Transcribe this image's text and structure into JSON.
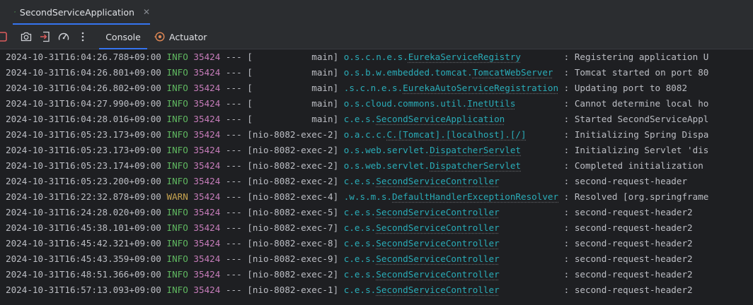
{
  "run_tab": {
    "title": "SecondServiceApplication",
    "close": "✕"
  },
  "toolbar": {
    "console_label": "Console",
    "actuator_label": "Actuator"
  },
  "log": [
    {
      "ts": "2024-10-31T16:04:26.788+09:00",
      "level": "INFO",
      "pid": "35424",
      "thread": "[           main]",
      "pkg": "o.s.c.n.e.s.",
      "cls": "EurekaServiceRegistry",
      "msg": ": Registering application U"
    },
    {
      "ts": "2024-10-31T16:04:26.801+09:00",
      "level": "INFO",
      "pid": "35424",
      "thread": "[           main]",
      "pkg": "o.s.b.w.embedded.tomcat.",
      "cls": "TomcatWebServer",
      "msg": ": Tomcat started on port 80"
    },
    {
      "ts": "2024-10-31T16:04:26.802+09:00",
      "level": "INFO",
      "pid": "35424",
      "thread": "[           main]",
      "pkg": ".s.c.n.e.s.",
      "cls": "EurekaAutoServiceRegistration",
      "msg": ": Updating port to 8082"
    },
    {
      "ts": "2024-10-31T16:04:27.990+09:00",
      "level": "INFO",
      "pid": "35424",
      "thread": "[           main]",
      "pkg": "o.s.cloud.commons.util.",
      "cls": "InetUtils",
      "msg": ": Cannot determine local ho"
    },
    {
      "ts": "2024-10-31T16:04:28.016+09:00",
      "level": "INFO",
      "pid": "35424",
      "thread": "[           main]",
      "pkg": "c.e.s.",
      "cls": "SecondServiceApplication",
      "msg": ": Started SecondServiceAppl"
    },
    {
      "ts": "2024-10-31T16:05:23.173+09:00",
      "level": "INFO",
      "pid": "35424",
      "thread": "[nio-8082-exec-2]",
      "pkg": "o.a.c.c.",
      "cls": "C.[Tomcat].[localhost].[/]",
      "msg": ": Initializing Spring Dispa"
    },
    {
      "ts": "2024-10-31T16:05:23.173+09:00",
      "level": "INFO",
      "pid": "35424",
      "thread": "[nio-8082-exec-2]",
      "pkg": "o.s.web.servlet.",
      "cls": "DispatcherServlet",
      "msg": ": Initializing Servlet 'dis"
    },
    {
      "ts": "2024-10-31T16:05:23.174+09:00",
      "level": "INFO",
      "pid": "35424",
      "thread": "[nio-8082-exec-2]",
      "pkg": "o.s.web.servlet.",
      "cls": "DispatcherServlet",
      "msg": ": Completed initialization"
    },
    {
      "ts": "2024-10-31T16:05:23.200+09:00",
      "level": "INFO",
      "pid": "35424",
      "thread": "[nio-8082-exec-2]",
      "pkg": "c.e.s.",
      "cls": "SecondServiceController",
      "msg": ": second-request-header"
    },
    {
      "ts": "2024-10-31T16:22:32.878+09:00",
      "level": "WARN",
      "pid": "35424",
      "thread": "[nio-8082-exec-4]",
      "pkg": ".w.s.m.s.",
      "cls": "DefaultHandlerExceptionResolver",
      "msg": ": Resolved [org.springframe"
    },
    {
      "ts": "2024-10-31T16:24:28.020+09:00",
      "level": "INFO",
      "pid": "35424",
      "thread": "[nio-8082-exec-5]",
      "pkg": "c.e.s.",
      "cls": "SecondServiceController",
      "msg": ": second-request-header2"
    },
    {
      "ts": "2024-10-31T16:45:38.101+09:00",
      "level": "INFO",
      "pid": "35424",
      "thread": "[nio-8082-exec-7]",
      "pkg": "c.e.s.",
      "cls": "SecondServiceController",
      "msg": ": second-request-header2"
    },
    {
      "ts": "2024-10-31T16:45:42.321+09:00",
      "level": "INFO",
      "pid": "35424",
      "thread": "[nio-8082-exec-8]",
      "pkg": "c.e.s.",
      "cls": "SecondServiceController",
      "msg": ": second-request-header2"
    },
    {
      "ts": "2024-10-31T16:45:43.359+09:00",
      "level": "INFO",
      "pid": "35424",
      "thread": "[nio-8082-exec-9]",
      "pkg": "c.e.s.",
      "cls": "SecondServiceController",
      "msg": ": second-request-header2"
    },
    {
      "ts": "2024-10-31T16:48:51.366+09:00",
      "level": "INFO",
      "pid": "35424",
      "thread": "[nio-8082-exec-2]",
      "pkg": "c.e.s.",
      "cls": "SecondServiceController",
      "msg": ": second-request-header2"
    },
    {
      "ts": "2024-10-31T16:57:13.093+09:00",
      "level": "INFO",
      "pid": "35424",
      "thread": "[nio-8082-exec-1]",
      "pkg": "c.e.s.",
      "cls": "SecondServiceController",
      "msg": ": second-request-header2"
    }
  ]
}
